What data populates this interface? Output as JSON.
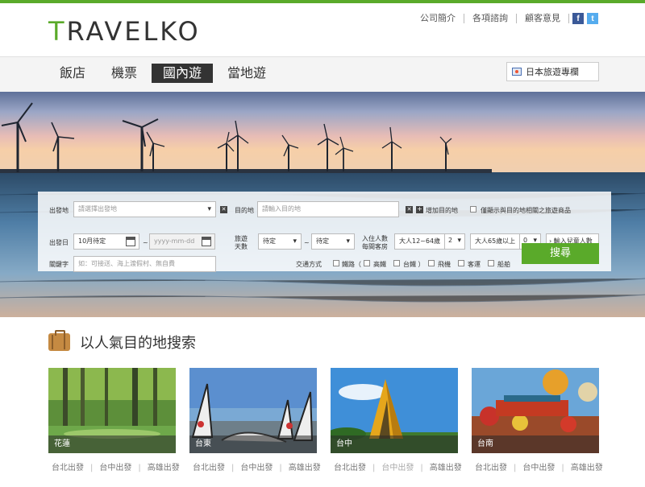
{
  "header": {
    "logo_first": "T",
    "logo_rest": "RAVELKO",
    "links": [
      "公司簡介",
      "各項諮詢",
      "顧客意見"
    ],
    "social": [
      {
        "icon": "facebook-icon",
        "glyph": "f"
      },
      {
        "icon": "twitter-icon",
        "glyph": "t"
      }
    ]
  },
  "nav": {
    "tabs": [
      "飯店",
      "機票",
      "國內遊",
      "當地遊"
    ],
    "active": 2,
    "japan_label": "日本旅遊專欄"
  },
  "search": {
    "depart_label": "出發地",
    "depart_placeholder": "請選擇出發地",
    "dest_label": "目的地",
    "dest_placeholder": "請輸入目的地",
    "add_dest": "增加目的地",
    "only_dest_label": "僅顯示與目的地相關之旅遊商品",
    "date_label": "出發日",
    "date_value": "10月待定",
    "date_end_placeholder": "yyyy-mm-dd",
    "tilde": "~",
    "days_label_1": "旅遊",
    "days_label_2": "天數",
    "days_from": "待定",
    "days_to": "待定",
    "people_label_1": "入住人數",
    "people_label_2": "每間客房",
    "adult_label": "大人12~64歲",
    "adult_count": "2",
    "senior_label": "大人65歲以上",
    "senior_count": "0",
    "child_button": "輸入兒童人數",
    "keyword_label": "關鍵字",
    "keyword_placeholder": "如：可接送、海上渡假村、無自費",
    "transport_label": "交通方式",
    "transport": [
      "鐵路（",
      "高鐵",
      "台鐵 ）",
      "飛機",
      "客運",
      "船舶"
    ],
    "search_button": "搜尋"
  },
  "popular": {
    "title": "以人氣目的地搜索",
    "cards": [
      {
        "name": "花蓮",
        "links": [
          "台北出發",
          "台中出發",
          "高雄出發"
        ]
      },
      {
        "name": "台東",
        "links": [
          "台北出發",
          "台中出發",
          "高雄出發"
        ]
      },
      {
        "name": "台中",
        "links": [
          "台北出發",
          "台中出發",
          "高雄出發"
        ]
      },
      {
        "name": "台南",
        "links": [
          "台北出發",
          "台中出發",
          "高雄出發"
        ]
      }
    ]
  },
  "colors": {
    "brand_green": "#5aaa2a",
    "facebook": "#3b5998",
    "twitter": "#55acee"
  }
}
